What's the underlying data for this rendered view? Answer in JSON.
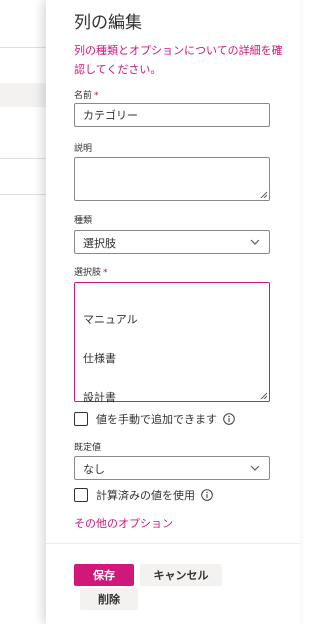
{
  "panel": {
    "title": "列の編集",
    "info_link": "列の種類とオプションについての詳細を確認してください。"
  },
  "name": {
    "label": "名前",
    "required": "*",
    "value": "カテゴリー"
  },
  "description": {
    "label": "説明",
    "value": ""
  },
  "type": {
    "label": "種類",
    "value": "選択肢"
  },
  "choices": {
    "label": "選択肢",
    "required": "*",
    "items": [
      "マニュアル",
      "仕様書",
      "設計書"
    ]
  },
  "manual_add": {
    "label": "値を手動で追加できます",
    "checked": false
  },
  "default_value": {
    "label": "既定値",
    "value": "なし"
  },
  "calculated": {
    "label": "計算済みの値を使用",
    "checked": false
  },
  "more_options": "その他のオプション",
  "buttons": {
    "save": "保存",
    "cancel": "キャンセル",
    "delete": "削除"
  },
  "colors": {
    "accent": "#d0177a",
    "required": "#a4262c"
  }
}
